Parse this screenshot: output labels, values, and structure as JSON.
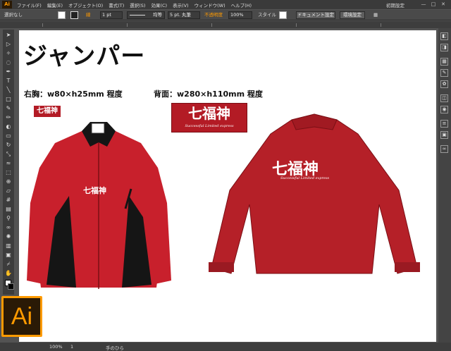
{
  "app": {
    "logo": "Ai",
    "menus": [
      "ファイル(F)",
      "編集(E)",
      "オブジェクト(O)",
      "書式(T)",
      "選択(S)",
      "効果(C)",
      "表示(V)",
      "ウィンドウ(W)",
      "ヘルプ(H)"
    ],
    "workspace": "初期設定",
    "window_controls": [
      "—",
      "□",
      "✕"
    ]
  },
  "control_bar": {
    "selection_state": "選択なし",
    "stroke_label": "線",
    "stroke_width": "1 pt",
    "brush_label": "均等",
    "profile_value": "5 pt. 丸筆",
    "opacity_label": "不透明度",
    "opacity_value": "100%",
    "style_label": "スタイル",
    "doc_setup_label": "ドキュメント設定",
    "prefs_label": "環境設定"
  },
  "status_bar": {
    "zoom": "100%",
    "tool_name": "手のひら",
    "artboard_num": "1"
  },
  "artwork": {
    "title": "ジャンパー",
    "front_caption": "右胸：w80×h25mm 程度",
    "back_caption": "背面：w280×h110mm 程度",
    "logo_text": "七福神",
    "logo_subtext": "Successful Limited express",
    "front_chest_text": "七福神",
    "back_text": "七福神",
    "back_subtext": "Successful Limited express"
  },
  "colors": {
    "jacket_red": "#c8202c",
    "back_red": "#b52028",
    "black": "#151515",
    "brand_orange": "#ff9a00"
  },
  "icons": {
    "tools": [
      "selection-icon",
      "direct-selection-icon",
      "magic-wand-icon",
      "lasso-icon",
      "pen-icon",
      "type-icon",
      "line-segment-icon",
      "rectangle-icon",
      "paintbrush-icon",
      "pencil-icon",
      "blob-brush-icon",
      "eraser-icon",
      "rotate-icon",
      "scale-icon",
      "width-icon",
      "free-transform-icon",
      "shape-builder-icon",
      "perspective-grid-icon",
      "mesh-icon",
      "gradient-icon",
      "eyedropper-icon",
      "blend-icon",
      "symbol-sprayer-icon",
      "column-graph-icon",
      "artboard-icon",
      "slice-icon",
      "hand-icon",
      "zoom-icon"
    ],
    "panels": [
      "color-panel-icon",
      "color-guide-icon",
      "swatches-icon",
      "brushes-icon",
      "symbols-icon",
      "graphic-styles-icon",
      "appearance-icon",
      "layers-icon",
      "artboards-icon",
      "links-icon"
    ]
  }
}
